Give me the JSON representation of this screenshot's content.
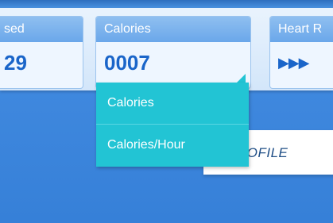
{
  "stats": {
    "left_tile": {
      "title": "sed",
      "value": "29"
    },
    "calories_tile": {
      "title": "Calories",
      "value": "0007"
    },
    "heart_tile": {
      "title": "Heart R",
      "value": "▶▶▶"
    }
  },
  "dropdown": {
    "icon": "dropdown-triangle-icon",
    "options": [
      "Calories",
      "Calories/Hour"
    ]
  },
  "profile_button": {
    "label": "ROFILE"
  },
  "colors": {
    "accent": "#22c4d4",
    "value_text": "#1a65c9",
    "tile_header": "#7ab3ec",
    "background": "#3f88de"
  }
}
